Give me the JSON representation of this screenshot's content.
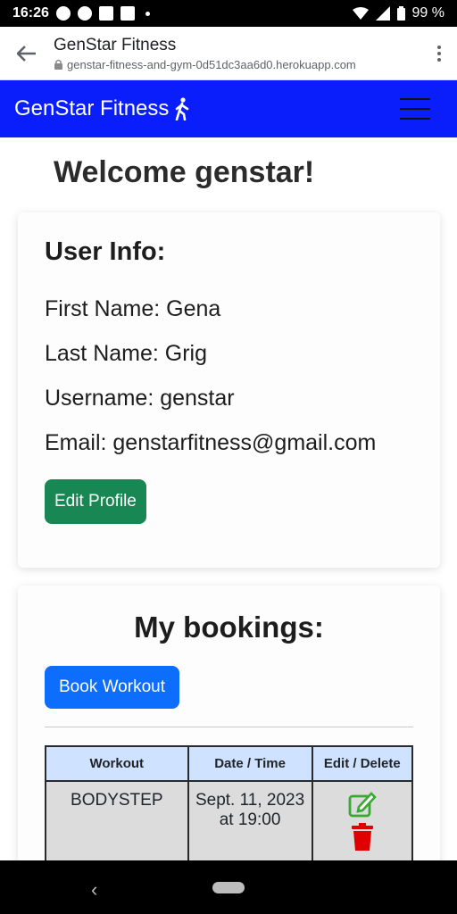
{
  "status_bar": {
    "time": "16:26",
    "battery": "99 %"
  },
  "browser": {
    "title": "GenStar Fitness",
    "url": "genstar-fitness-and-gym-0d51dc3aa6d0.herokuapp.com"
  },
  "navbar": {
    "brand": "GenStar Fitness"
  },
  "welcome": "Welcome genstar!",
  "user_info": {
    "title": "User Info:",
    "first_name": "First Name: Gena",
    "last_name": "Last Name: Grig",
    "username": "Username: genstar",
    "email": "Email: genstarfitness@gmail.com",
    "edit_button": "Edit Profile"
  },
  "bookings": {
    "title": "My bookings:",
    "book_button": "Book Workout",
    "columns": [
      "Workout",
      "Date / Time",
      "Edit / Delete"
    ],
    "rows": [
      {
        "workout": "BODYSTEP",
        "datetime": "Sept. 11, 2023 at 19:00"
      }
    ]
  },
  "colors": {
    "navbar": "#0a1efc",
    "edit_button": "#198754",
    "book_button": "#0d6efd",
    "header_row": "#cfe2ff",
    "edit_icon": "#3aa832",
    "delete_icon": "#e00000"
  }
}
